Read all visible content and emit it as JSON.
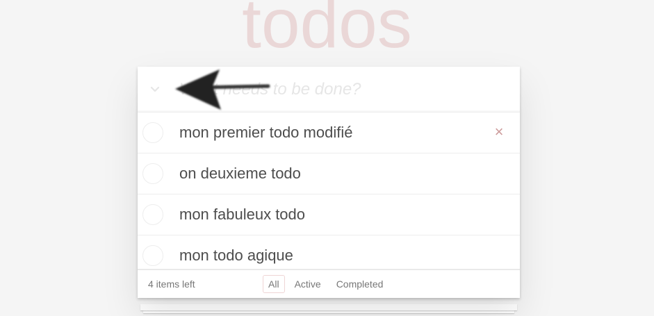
{
  "app": {
    "title": "todos"
  },
  "header": {
    "new_todo_placeholder": "What needs to be done?"
  },
  "todos": [
    {
      "label": "mon premier todo modifié",
      "completed": false,
      "hovered": true
    },
    {
      "label": "on deuxieme todo",
      "completed": false,
      "hovered": false
    },
    {
      "label": "mon fabuleux todo",
      "completed": false,
      "hovered": false
    },
    {
      "label": "mon todo agique",
      "completed": false,
      "hovered": false
    }
  ],
  "footer": {
    "count_text": "4 items left",
    "filters": [
      {
        "label": "All",
        "selected": true
      },
      {
        "label": "Active",
        "selected": false
      },
      {
        "label": "Completed",
        "selected": false
      }
    ]
  },
  "icons": {
    "toggle_all": "chevron-down-icon",
    "destroy": "close-icon",
    "cursor": "arrow-left-icon"
  },
  "colors": {
    "title": "#efd5d5",
    "destroy": "#cc9a9a",
    "background": "#f5f5f5"
  }
}
